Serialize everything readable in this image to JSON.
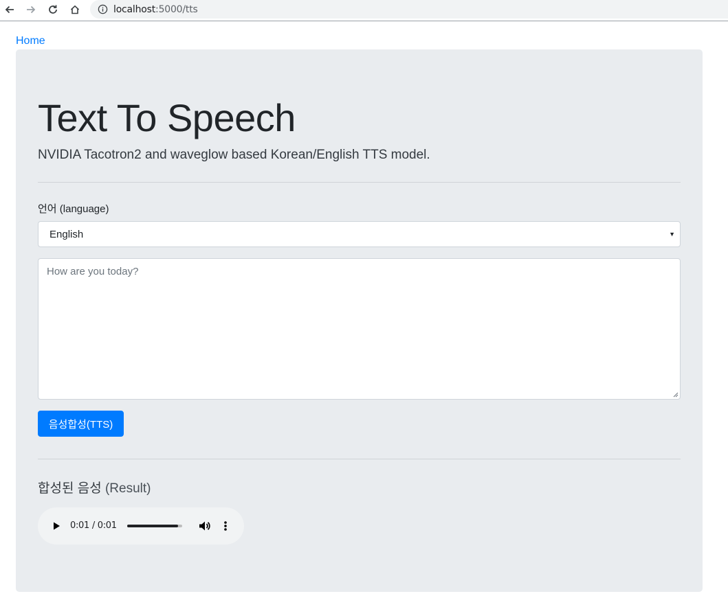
{
  "browser": {
    "url_host": "localhost",
    "url_path": ":5000/tts"
  },
  "nav": {
    "home_link": "Home"
  },
  "header": {
    "title": "Text To Speech",
    "subtitle": "NVIDIA Tacotron2 and waveglow based Korean/English TTS model."
  },
  "form": {
    "language_label": "언어 (language)",
    "language_selected": "English",
    "text_placeholder": "How are you today?",
    "submit_label": "음성합성(TTS)"
  },
  "result": {
    "heading_main": "합성된 음성",
    "heading_sub": "(Result)",
    "audio": {
      "time": "0:01 / 0:01",
      "progress_fraction": 0.93
    }
  },
  "colors": {
    "primary": "#007bff",
    "jumbotron_bg": "#e9ecef"
  }
}
